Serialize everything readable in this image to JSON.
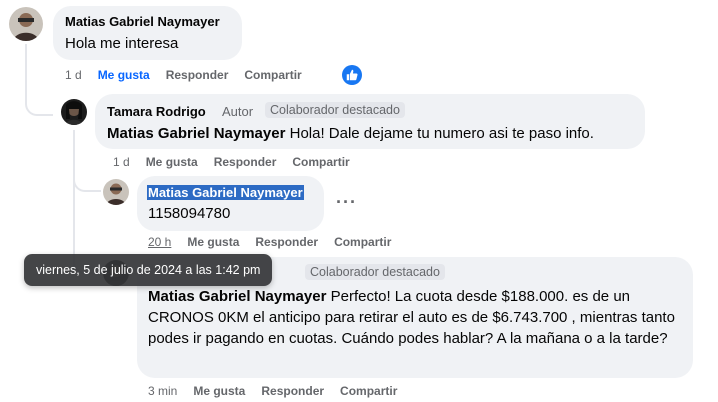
{
  "comments": [
    {
      "author": "Matias Gabriel Naymayer",
      "text": "Hola me interesa",
      "time": "1 d",
      "like": "Me gusta",
      "reply": "Responder",
      "share": "Compartir"
    },
    {
      "author": "Tamara Rodrigo",
      "role": "Autor",
      "badge": "Colaborador destacado",
      "mention": "Matias Gabriel Naymayer",
      "text": " Hola! Dale dejame tu numero asi te paso info.",
      "time": "1 d",
      "like": "Me gusta",
      "reply": "Responder",
      "share": "Compartir"
    },
    {
      "author": "Matias Gabriel Naymayer",
      "text": "1158094780",
      "time": "20 h",
      "like": "Me gusta",
      "reply": "Responder",
      "share": "Compartir",
      "more": "···"
    },
    {
      "badge": "Colaborador destacado",
      "mention": "Matias Gabriel Naymayer",
      "text": " Perfecto! La cuota desde $188.000. es de un CRONOS 0KM el anticipo para retirar el auto es de $6.743.700 , mientras tanto podes ir pagando en cuotas. Cuándo podes hablar? A la mañana o a la tarde?",
      "time": "3 min",
      "like": "Me gusta",
      "reply": "Responder",
      "share": "Compartir"
    }
  ],
  "tooltip": "viernes, 5 de julio de 2024 a las 1:42 pm",
  "colors": {
    "bubble": "#f0f2f5",
    "bubble_highlight": "#e7f3ff",
    "liked": "#0866ff",
    "muted": "#65676b",
    "selection": "#2d6bc4"
  },
  "icons": [
    "like-thumb-icon",
    "more-dots-icon"
  ]
}
